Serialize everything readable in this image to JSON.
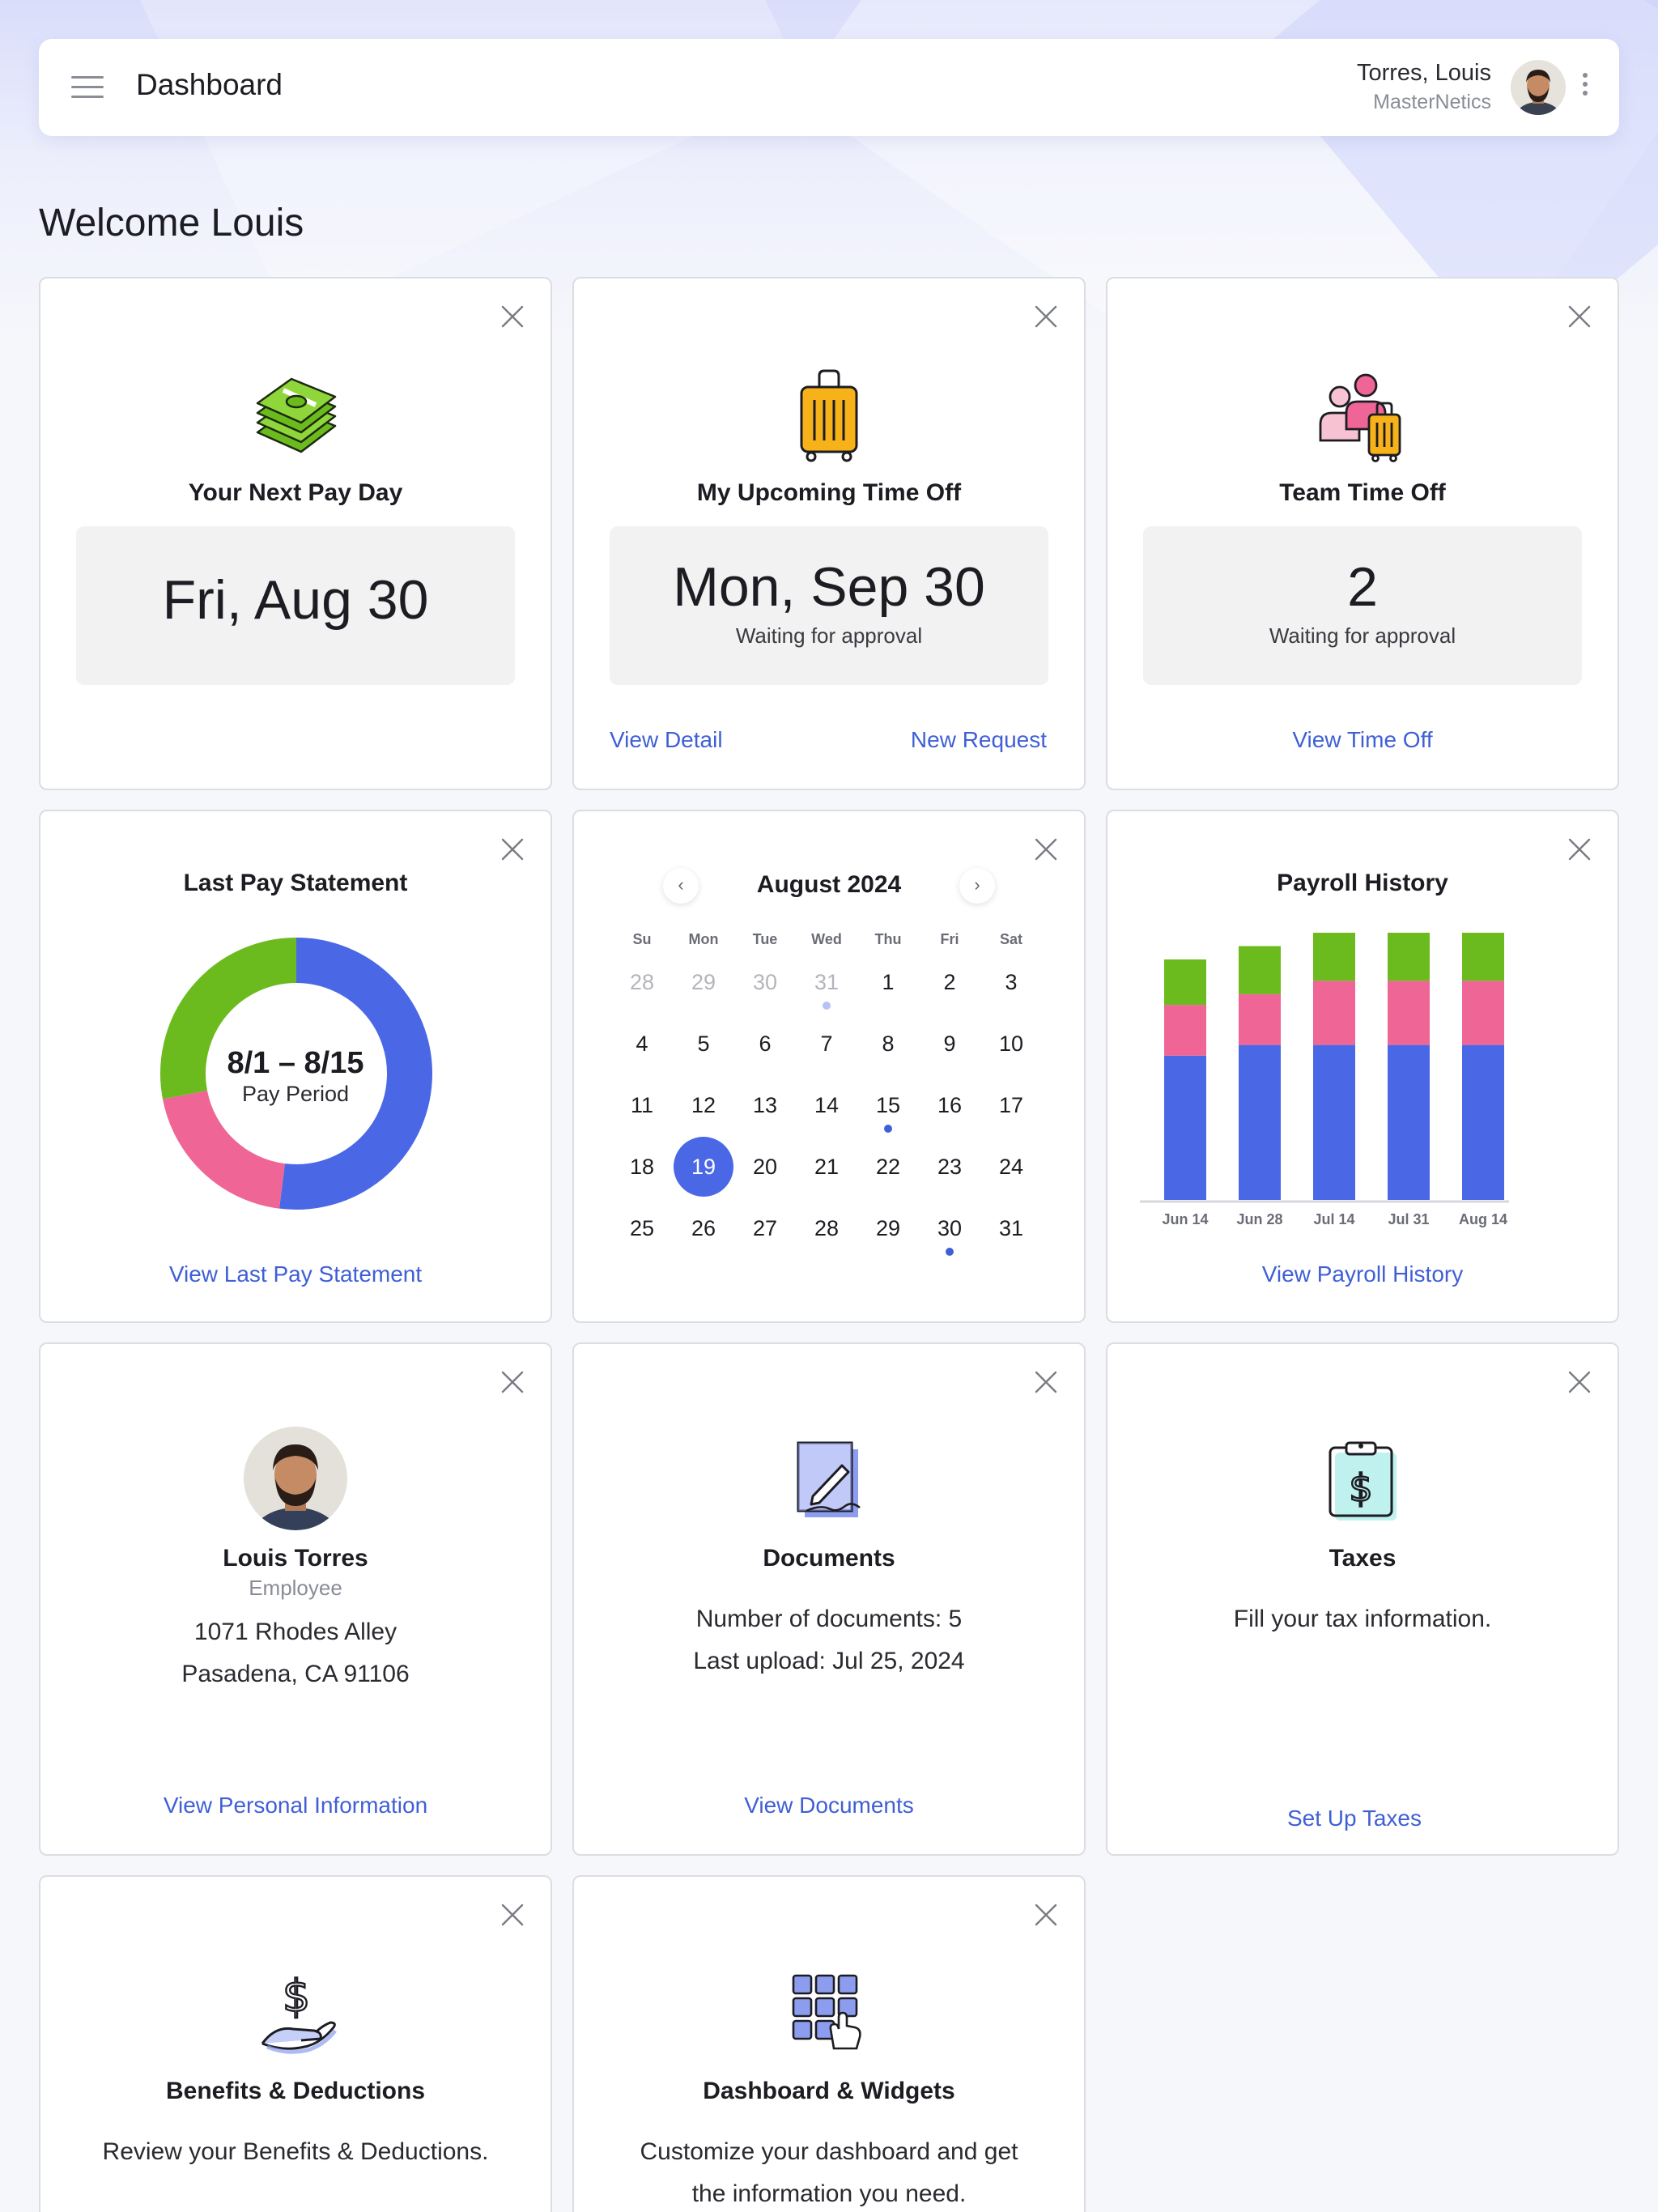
{
  "header": {
    "title": "Dashboard",
    "user_name": "Torres, Louis",
    "company": "MasterNetics"
  },
  "welcome": "Welcome Louis",
  "colors": {
    "accent": "#3f5fd6",
    "blue": "#4a68e6",
    "pink": "#ef6595",
    "green": "#6cbb1e"
  },
  "cards": {
    "pay_day": {
      "icon": "money-stack-icon",
      "title": "Your Next Pay Day",
      "value": "Fri, Aug 30"
    },
    "time_off": {
      "icon": "suitcase-icon",
      "title": "My Upcoming Time Off",
      "value": "Mon, Sep 30",
      "status": "Waiting for approval",
      "link_detail": "View Detail",
      "link_new": "New Request"
    },
    "team_time_off": {
      "icon": "team-suitcase-icon",
      "title": "Team Time Off",
      "value": "2",
      "status": "Waiting for approval",
      "link": "View Time Off"
    },
    "pay_statement": {
      "title": "Last Pay Statement",
      "period": "8/1 – 8/15",
      "period_label": "Pay Period",
      "link": "View Last Pay Statement"
    },
    "calendar": {
      "month": "August 2024",
      "weekdays": [
        "Su",
        "Mon",
        "Tue",
        "Wed",
        "Thu",
        "Fri",
        "Sat"
      ],
      "weeks": [
        [
          "28",
          "29",
          "30",
          "31",
          "1",
          "2",
          "3"
        ],
        [
          "4",
          "5",
          "6",
          "7",
          "8",
          "9",
          "10"
        ],
        [
          "11",
          "12",
          "13",
          "14",
          "15",
          "16",
          "17"
        ],
        [
          "18",
          "19",
          "20",
          "21",
          "22",
          "23",
          "24"
        ],
        [
          "25",
          "26",
          "27",
          "28",
          "29",
          "30",
          "31"
        ]
      ],
      "selected_day": "19",
      "event_days": [
        "31-prev",
        "15",
        "30"
      ]
    },
    "payroll_history": {
      "title": "Payroll History",
      "link": "View Payroll History"
    },
    "personal": {
      "name": "Louis Torres",
      "role": "Employee",
      "address1": "1071 Rhodes Alley",
      "address2": "Pasadena, CA 91106",
      "link": "View Personal Information"
    },
    "documents": {
      "icon": "document-sign-icon",
      "title": "Documents",
      "line1": "Number of documents: 5",
      "line2": "Last upload: Jul 25, 2024",
      "link": "View Documents"
    },
    "taxes": {
      "icon": "tax-clipboard-icon",
      "title": "Taxes",
      "text": "Fill your tax information.",
      "link": "Set Up Taxes"
    },
    "benefits": {
      "icon": "hand-dollar-icon",
      "title": "Benefits & Deductions",
      "text": "Review your Benefits & Deductions."
    },
    "widgets": {
      "icon": "grid-pointer-icon",
      "title": "Dashboard & Widgets",
      "text1": "Customize your dashboard and get",
      "text2": "the information you need."
    }
  },
  "chart_data": [
    {
      "type": "pie",
      "title": "Last Pay Statement",
      "slices": [
        {
          "label": "blue",
          "value": 0.52,
          "color": "#4a68e6"
        },
        {
          "label": "pink",
          "value": 0.2,
          "color": "#ef6595"
        },
        {
          "label": "green",
          "value": 0.28,
          "color": "#6cbb1e"
        }
      ]
    },
    {
      "type": "bar",
      "title": "Payroll History",
      "stacked": true,
      "categories": [
        "Jun 14",
        "Jun 28",
        "Jul 14",
        "Jul 31",
        "Aug 14"
      ],
      "series": [
        {
          "color": "#4a68e6",
          "values": [
            54,
            58,
            58,
            58,
            58
          ]
        },
        {
          "color": "#ef6595",
          "values": [
            19,
            19,
            24,
            24,
            24
          ]
        },
        {
          "color": "#6cbb1e",
          "values": [
            17,
            18,
            19,
            19,
            19
          ]
        }
      ],
      "ylim": [
        0,
        100
      ]
    }
  ]
}
